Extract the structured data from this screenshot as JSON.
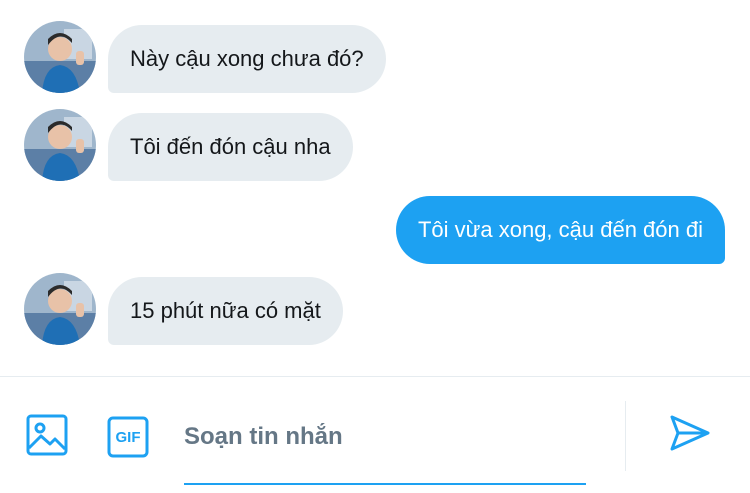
{
  "messages": [
    {
      "direction": "in",
      "text": "Này cậu xong chưa đó?"
    },
    {
      "direction": "in",
      "text": "Tôi đến đón cậu nha"
    },
    {
      "direction": "out",
      "text": "Tôi vừa xong, cậu đến đón đi"
    },
    {
      "direction": "in",
      "text": "15 phút nữa có mặt"
    }
  ],
  "composer": {
    "placeholder": "Soạn tin nhắn",
    "gif_label": "GIF"
  },
  "colors": {
    "accent": "#1da1f2",
    "incoming_bubble": "#e6ecf0",
    "placeholder": "#657786"
  },
  "icons": {
    "media": "image-icon",
    "gif": "gif-icon",
    "send": "send-icon"
  }
}
